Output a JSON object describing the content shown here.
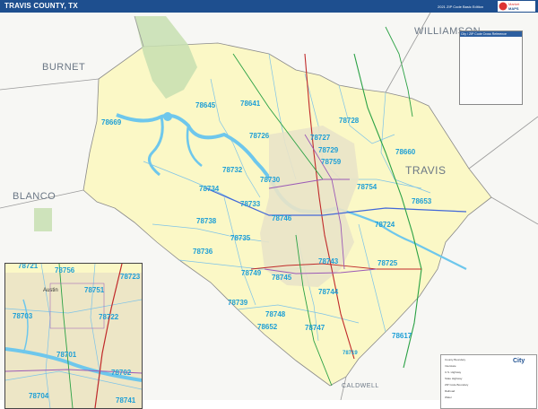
{
  "header": {
    "title": "TRAVIS COUNTY, TX",
    "edition": "2021 ZIP Code Basic Edition",
    "logo": "Market MAPS"
  },
  "counties": {
    "williamson": "WILLIAMSON",
    "burnet": "BURNET",
    "blanco": "BLANCO",
    "travis": "TRAVIS",
    "caldwell": "CALDWELL"
  },
  "zips": [
    {
      "code": "78669"
    },
    {
      "code": "78645"
    },
    {
      "code": "78641"
    },
    {
      "code": "78726"
    },
    {
      "code": "78727"
    },
    {
      "code": "78728"
    },
    {
      "code": "78729"
    },
    {
      "code": "78759"
    },
    {
      "code": "78660"
    },
    {
      "code": "78732"
    },
    {
      "code": "78734"
    },
    {
      "code": "78730"
    },
    {
      "code": "78754"
    },
    {
      "code": "78733"
    },
    {
      "code": "78746"
    },
    {
      "code": "78653"
    },
    {
      "code": "78738"
    },
    {
      "code": "78724"
    },
    {
      "code": "78735"
    },
    {
      "code": "78736"
    },
    {
      "code": "78743"
    },
    {
      "code": "78725"
    },
    {
      "code": "78749"
    },
    {
      "code": "78745"
    },
    {
      "code": "78744"
    },
    {
      "code": "78739"
    },
    {
      "code": "78748"
    },
    {
      "code": "78652"
    },
    {
      "code": "78747"
    },
    {
      "code": "78617"
    },
    {
      "code": "78719"
    }
  ],
  "inset": {
    "city": "Austin",
    "zips": [
      "78756",
      "78723",
      "78751",
      "78703",
      "78722",
      "78701",
      "78702",
      "78704",
      "78741",
      "78721"
    ]
  },
  "legend": {
    "title": "City",
    "entries": [
      "County Boundary",
      "Interstate",
      "U.S. Highway",
      "State Highway",
      "ZIP Code Boundary",
      "Railroad",
      "Water"
    ]
  },
  "lookup": {
    "title": "City / ZIP Code Cross Reference"
  }
}
